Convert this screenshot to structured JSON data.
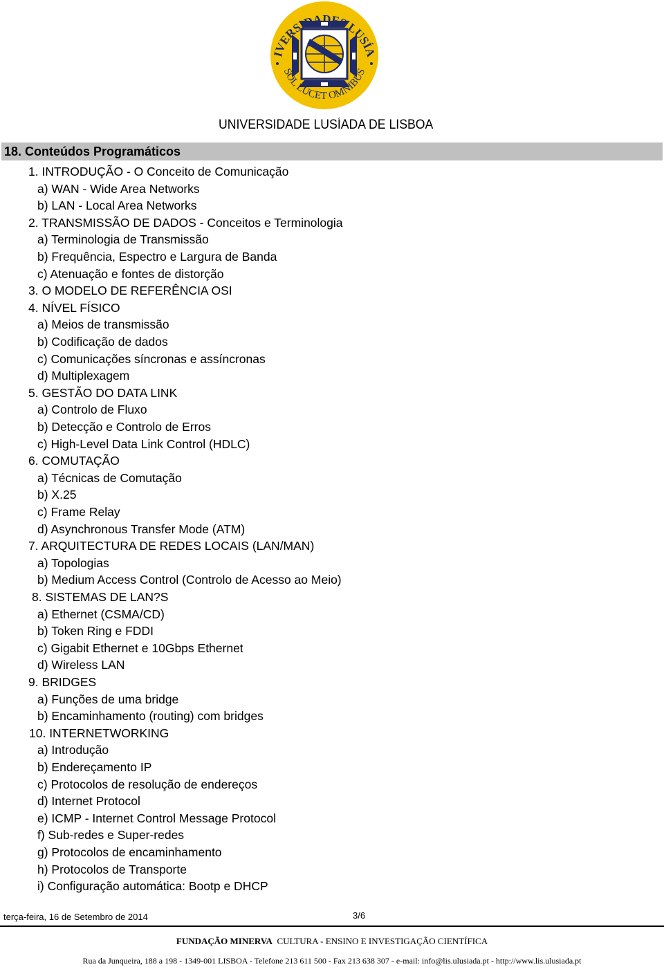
{
  "header": {
    "logo": {
      "ring_text_top": "UNIVERSIDADES LUSÍADA",
      "ring_text_bottom": "SOL LUCET OMNIBUS",
      "colors": {
        "navy": "#1f2a6b",
        "gold": "#f2c200"
      }
    },
    "institution": "UNIVERSIDADE LUSÍADA DE LISBOA"
  },
  "section": {
    "title": "18. Conteúdos Programáticos",
    "bar_color": "#c0c0c0"
  },
  "items": [
    {
      "level": 1,
      "text": "1. INTRODUÇÃO - O Conceito de Comunicação"
    },
    {
      "level": 2,
      "text": "a) WAN - Wide Area Networks"
    },
    {
      "level": 2,
      "text": "b) LAN - Local Area Networks"
    },
    {
      "level": 1,
      "text": "2. TRANSMISSÃO DE DADOS - Conceitos e Terminologia"
    },
    {
      "level": 2,
      "text": "a) Terminologia de Transmissão"
    },
    {
      "level": 2,
      "text": "b) Frequência, Espectro e Largura de Banda"
    },
    {
      "level": 2,
      "text": "c) Atenuação e fontes de distorção"
    },
    {
      "level": 1,
      "text": "3. O MODELO DE REFERÊNCIA OSI"
    },
    {
      "level": 1,
      "text": "4. NÍVEL FÍSICO"
    },
    {
      "level": 2,
      "text": "a) Meios de transmissão"
    },
    {
      "level": 2,
      "text": "b) Codificação de dados"
    },
    {
      "level": 2,
      "text": "c) Comunicações síncronas e assíncronas"
    },
    {
      "level": 2,
      "text": "d) Multiplexagem"
    },
    {
      "level": 1,
      "text": "5. GESTÃO DO DATA LINK"
    },
    {
      "level": 2,
      "text": "a) Controlo de Fluxo"
    },
    {
      "level": 2,
      "text": "b) Detecção e Controlo de Erros"
    },
    {
      "level": 2,
      "text": "c) High-Level Data Link Control (HDLC)"
    },
    {
      "level": 1,
      "text": "6. COMUTAÇÃO"
    },
    {
      "level": 2,
      "text": "a) Técnicas de Comutação"
    },
    {
      "level": 2,
      "text": "b) X.25"
    },
    {
      "level": 2,
      "text": "c) Frame Relay"
    },
    {
      "level": 2,
      "text": "d) Asynchronous Transfer Mode (ATM)"
    },
    {
      "level": 1,
      "text": "7. ARQUITECTURA DE REDES LOCAIS (LAN/MAN)"
    },
    {
      "level": 2,
      "text": "a) Topologias"
    },
    {
      "level": 2,
      "text": "b) Medium Access Control (Controlo de Acesso ao Meio)"
    },
    {
      "level": 1,
      "text": "8. SISTEMAS DE LAN?S"
    },
    {
      "level": 2,
      "text": "a) Ethernet (CSMA/CD)"
    },
    {
      "level": 2,
      "text": "b) Token Ring e FDDI"
    },
    {
      "level": 2,
      "text": "c) Gigabit Ethernet  e 10Gbps Ethernet"
    },
    {
      "level": 2,
      "text": "d) Wireless LAN"
    },
    {
      "level": 1,
      "text": "9. BRIDGES"
    },
    {
      "level": 2,
      "text": "a) Funções de uma bridge"
    },
    {
      "level": 2,
      "text": "b) Encaminhamento (routing) com bridges"
    },
    {
      "level": 1,
      "text": "10. INTERNETWORKING"
    },
    {
      "level": 2,
      "text": "a) Introdução"
    },
    {
      "level": 2,
      "text": "b) Endereçamento IP"
    },
    {
      "level": 2,
      "text": "c) Protocolos de resolução de endereços"
    },
    {
      "level": 2,
      "text": "d) Internet Protocol"
    },
    {
      "level": 2,
      "text": "e) ICMP - Internet Control Message Protocol"
    },
    {
      "level": 2,
      "text": "f) Sub-redes e Super-redes"
    },
    {
      "level": 2,
      "text": "g) Protocolos de encaminhamento"
    },
    {
      "level": 2,
      "text": "h) Protocolos de Transporte"
    },
    {
      "level": 2,
      "text": "i) Configuração automática: Bootp e DHCP"
    }
  ],
  "footer": {
    "date": "terça-feira, 16 de Setembro de 2014",
    "page": "3/6",
    "org_name": "FUNDAÇÃO MINERVA",
    "org_tagline": "CULTURA - ENSINO E INVESTIGAÇÃO CIENTÍFICA",
    "address": "Rua da Junqueira, 188 a 198 - 1349-001 LISBOA - Telefone 213 611 500 - Fax 213 638 307 - e-mail: info@lis.ulusiada.pt - http://www.lis.ulusiada.pt"
  }
}
